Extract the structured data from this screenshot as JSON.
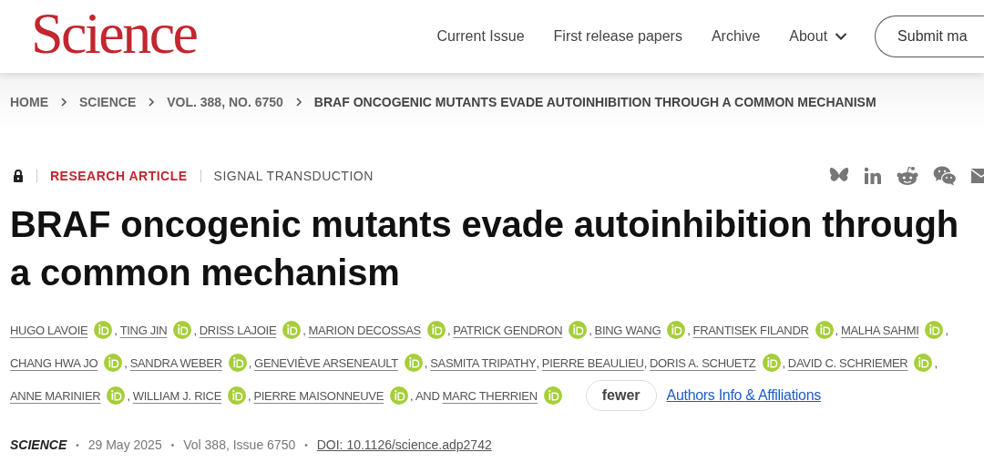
{
  "header": {
    "logo": "Science",
    "nav": [
      {
        "label": "Current Issue",
        "dropdown": false
      },
      {
        "label": "First release papers",
        "dropdown": false
      },
      {
        "label": "Archive",
        "dropdown": false
      },
      {
        "label": "About",
        "dropdown": true
      }
    ],
    "action": "Submit ma"
  },
  "breadcrumb": [
    "HOME",
    "SCIENCE",
    "VOL. 388, NO. 6750",
    "BRAF ONCOGENIC MUTANTS EVADE AUTOINHIBITION THROUGH A COMMON MECHANISM"
  ],
  "article": {
    "locked": true,
    "type": "RESEARCH ARTICLE",
    "subject": "SIGNAL TRANSDUCTION",
    "title": "BRAF oncogenic mutants evade autoinhibition through a common mechanism",
    "author_lines": [
      [
        {
          "name": "HUGO LAVOIE",
          "orcid": true,
          "sep": ","
        },
        {
          "name": "TING JIN",
          "orcid": true,
          "sep": ","
        },
        {
          "name": "DRISS LAJOIE",
          "orcid": true,
          "sep": ","
        },
        {
          "name": "MARION DECOSSAS",
          "orcid": true,
          "sep": ","
        },
        {
          "name": "PATRICK GENDRON",
          "orcid": true,
          "sep": ","
        },
        {
          "name": "BING WANG",
          "orcid": true,
          "sep": ","
        },
        {
          "name": "FRANTISEK FILANDR",
          "orcid": true,
          "sep": ","
        },
        {
          "name": "MALHA SAHMI",
          "orcid": true,
          "sep": ","
        }
      ],
      [
        {
          "name": "CHANG HWA JO",
          "orcid": true,
          "sep": ","
        },
        {
          "name": "SANDRA WEBER",
          "orcid": true,
          "sep": ","
        },
        {
          "name": "GENEVIÈVE ARSENEAULT",
          "orcid": true,
          "sep": ","
        },
        {
          "name": "SASMITA TRIPATHY",
          "orcid": false,
          "sep": ","
        },
        {
          "name": "PIERRE BEAULIEU",
          "orcid": false,
          "sep": ","
        },
        {
          "name": "DORIS A. SCHUETZ",
          "orcid": true,
          "sep": ","
        },
        {
          "name": "DAVID C. SCHRIEMER",
          "orcid": true,
          "sep": ","
        }
      ],
      [
        {
          "name": "ANNE MARINIER",
          "orcid": true,
          "sep": ","
        },
        {
          "name": "WILLIAM J. RICE",
          "orcid": true,
          "sep": ","
        },
        {
          "name": "PIERRE MAISONNEUVE",
          "orcid": true,
          "sep": ", AND"
        },
        {
          "name": "MARC THERRIEN",
          "orcid": true
        }
      ]
    ],
    "fewer_button": "fewer",
    "affiliations_link": "Authors Info & Affiliations",
    "journal": "SCIENCE",
    "footer_separator": "•",
    "date": "29 May 2025",
    "issue": "Vol 388, Issue 6750",
    "doi": "DOI: 10.1126/science.adp2742"
  }
}
